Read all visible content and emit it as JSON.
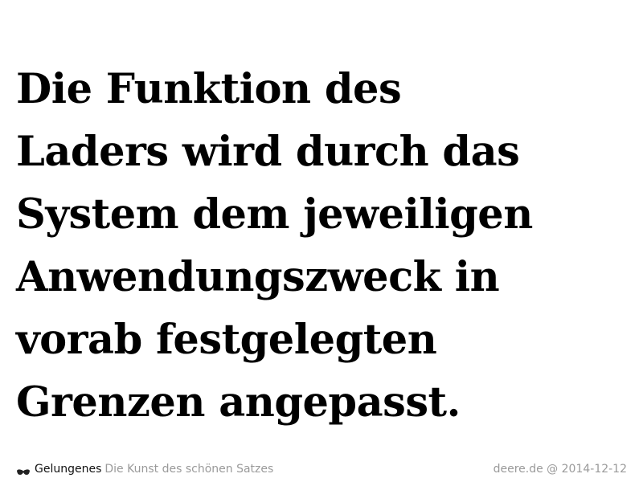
{
  "quote": {
    "lines": [
      "Die Funktion des",
      "Laders wird durch das",
      "System dem jeweiligen",
      "Anwendungszweck in",
      "vorab festgelegten",
      "Grenzen angepasst."
    ]
  },
  "footer": {
    "brand_icon": "glasses-icon",
    "brand": "Gelungenes",
    "tagline": "Die Kunst des schönen Satzes",
    "credit": "deere.de @ 2014-12-12"
  },
  "colors": {
    "text": "#000000",
    "muted": "#9a9a9a"
  }
}
